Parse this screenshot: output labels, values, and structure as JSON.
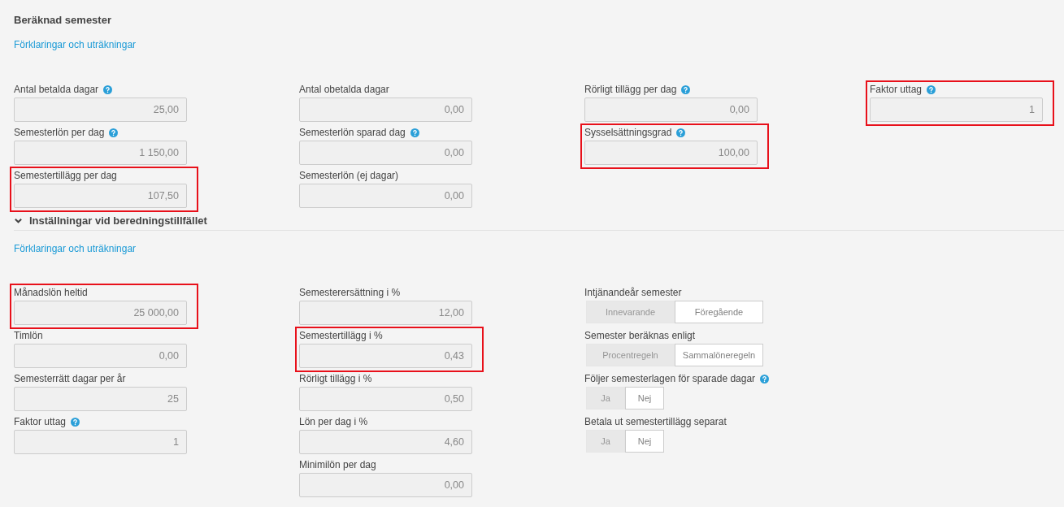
{
  "sections": [
    {
      "title": "Beräknad semester",
      "link": "Förklaringar och uträkningar",
      "columns": [
        [
          {
            "kind": "number",
            "label": "Antal betalda dagar",
            "help": true,
            "value": "25,00",
            "highlighted": false
          },
          {
            "kind": "number",
            "label": "Semesterlön per dag",
            "help": true,
            "value": "1 150,00",
            "highlighted": false
          },
          {
            "kind": "number",
            "label": "Semestertillägg per dag",
            "help": false,
            "value": "107,50",
            "highlighted": true
          }
        ],
        [
          {
            "kind": "number",
            "label": "Antal obetalda dagar",
            "help": false,
            "value": "0,00",
            "highlighted": false
          },
          {
            "kind": "number",
            "label": "Semesterlön sparad dag",
            "help": true,
            "value": "0,00",
            "highlighted": false
          },
          {
            "kind": "number",
            "label": "Semesterlön (ej dagar)",
            "help": false,
            "value": "0,00",
            "highlighted": false
          }
        ],
        [
          {
            "kind": "number",
            "label": "Rörligt tillägg per dag",
            "help": true,
            "value": "0,00",
            "highlighted": false
          },
          {
            "kind": "number",
            "label": "Sysselsättningsgrad",
            "help": true,
            "value": "100,00",
            "highlighted": true
          }
        ],
        [
          {
            "kind": "number",
            "label": "Faktor uttag",
            "help": true,
            "value": "1",
            "highlighted": true
          }
        ]
      ]
    },
    {
      "title": "Inställningar vid beredningstillfället",
      "expanded": true,
      "link": "Förklaringar och uträkningar",
      "columns": [
        [
          {
            "kind": "number",
            "label": "Månadslön heltid",
            "help": false,
            "value": "25 000,00",
            "highlighted": true
          },
          {
            "kind": "number",
            "label": "Timlön",
            "help": false,
            "value": "0,00",
            "highlighted": false
          },
          {
            "kind": "number",
            "label": "Semesterrätt dagar per år",
            "help": false,
            "value": "25",
            "highlighted": false
          },
          {
            "kind": "number",
            "label": "Faktor uttag",
            "help": true,
            "value": "1",
            "highlighted": false
          }
        ],
        [
          {
            "kind": "number",
            "label": "Semesterersättning i %",
            "help": false,
            "value": "12,00",
            "highlighted": false
          },
          {
            "kind": "number",
            "label": "Semestertillägg i %",
            "help": false,
            "value": "0,43",
            "highlighted": true
          },
          {
            "kind": "number",
            "label": "Rörligt tillägg i %",
            "help": false,
            "value": "0,50",
            "highlighted": false
          },
          {
            "kind": "number",
            "label": "Lön per dag i %",
            "help": false,
            "value": "4,60",
            "highlighted": false
          },
          {
            "kind": "number",
            "label": "Minimilön per dag",
            "help": false,
            "value": "0,00",
            "highlighted": false
          }
        ],
        [
          {
            "kind": "segmented",
            "label": "Intjänandeår semester",
            "help": false,
            "highlighted": false,
            "options": [
              {
                "label": "Innevarande",
                "selected": false
              },
              {
                "label": "Föregående",
                "selected": true
              }
            ]
          },
          {
            "kind": "segmented",
            "label": "Semester beräknas enligt",
            "help": false,
            "highlighted": false,
            "options": [
              {
                "label": "Procentregeln",
                "selected": false
              },
              {
                "label": "Sammalöneregeln",
                "selected": true
              }
            ]
          },
          {
            "kind": "toggle",
            "label": "Följer semesterlagen för sparade dagar",
            "help": true,
            "highlighted": false,
            "options": [
              {
                "label": "Ja",
                "selected": false
              },
              {
                "label": "Nej",
                "selected": true
              }
            ]
          },
          {
            "kind": "toggle",
            "label": "Betala ut semestertillägg separat",
            "help": false,
            "highlighted": false,
            "options": [
              {
                "label": "Ja",
                "selected": false
              },
              {
                "label": "Nej",
                "selected": true
              }
            ]
          }
        ],
        []
      ]
    }
  ]
}
